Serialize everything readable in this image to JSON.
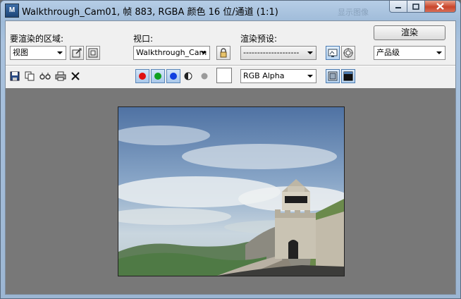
{
  "window": {
    "title": "Walkthrough_Cam01, 帧 883, RGBA 颜色 16 位/通道 (1:1)",
    "app_icon_text": "M",
    "background_ghost_text": "显示图像"
  },
  "controls": {
    "area_label": "要渲染的区域:",
    "area_value": "视图",
    "viewport_label": "视口:",
    "viewport_value": "Walkthrough_Cam",
    "preset_label": "渲染预设:",
    "preset_value": "--------------------",
    "render_button": "渲染",
    "quality_value": "产品级"
  },
  "toolbar": {
    "channel_value": "RGB Alpha",
    "channels": [
      {
        "name": "red",
        "color": "#e01010"
      },
      {
        "name": "green",
        "color": "#10a020"
      },
      {
        "name": "blue",
        "color": "#1040e0"
      }
    ],
    "swatch_color": "#ffffff"
  },
  "icons": {
    "app": "3ds-max-icon",
    "save": "save-icon",
    "copy": "copy-icon",
    "clone": "clone-window-icon",
    "print": "print-icon",
    "clear": "clear-icon",
    "lock": "lock-icon",
    "edit_area": "edit-region-icon",
    "auto_region": "auto-region-icon",
    "render_setup": "render-setup-icon",
    "environment": "environment-icon",
    "mono": "monochrome-icon",
    "gray": "gray-dot-icon"
  },
  "colors": {
    "frame_blue": "#a9c2de",
    "client_bg": "#f0f0f0",
    "viewport_bg": "#787878"
  }
}
